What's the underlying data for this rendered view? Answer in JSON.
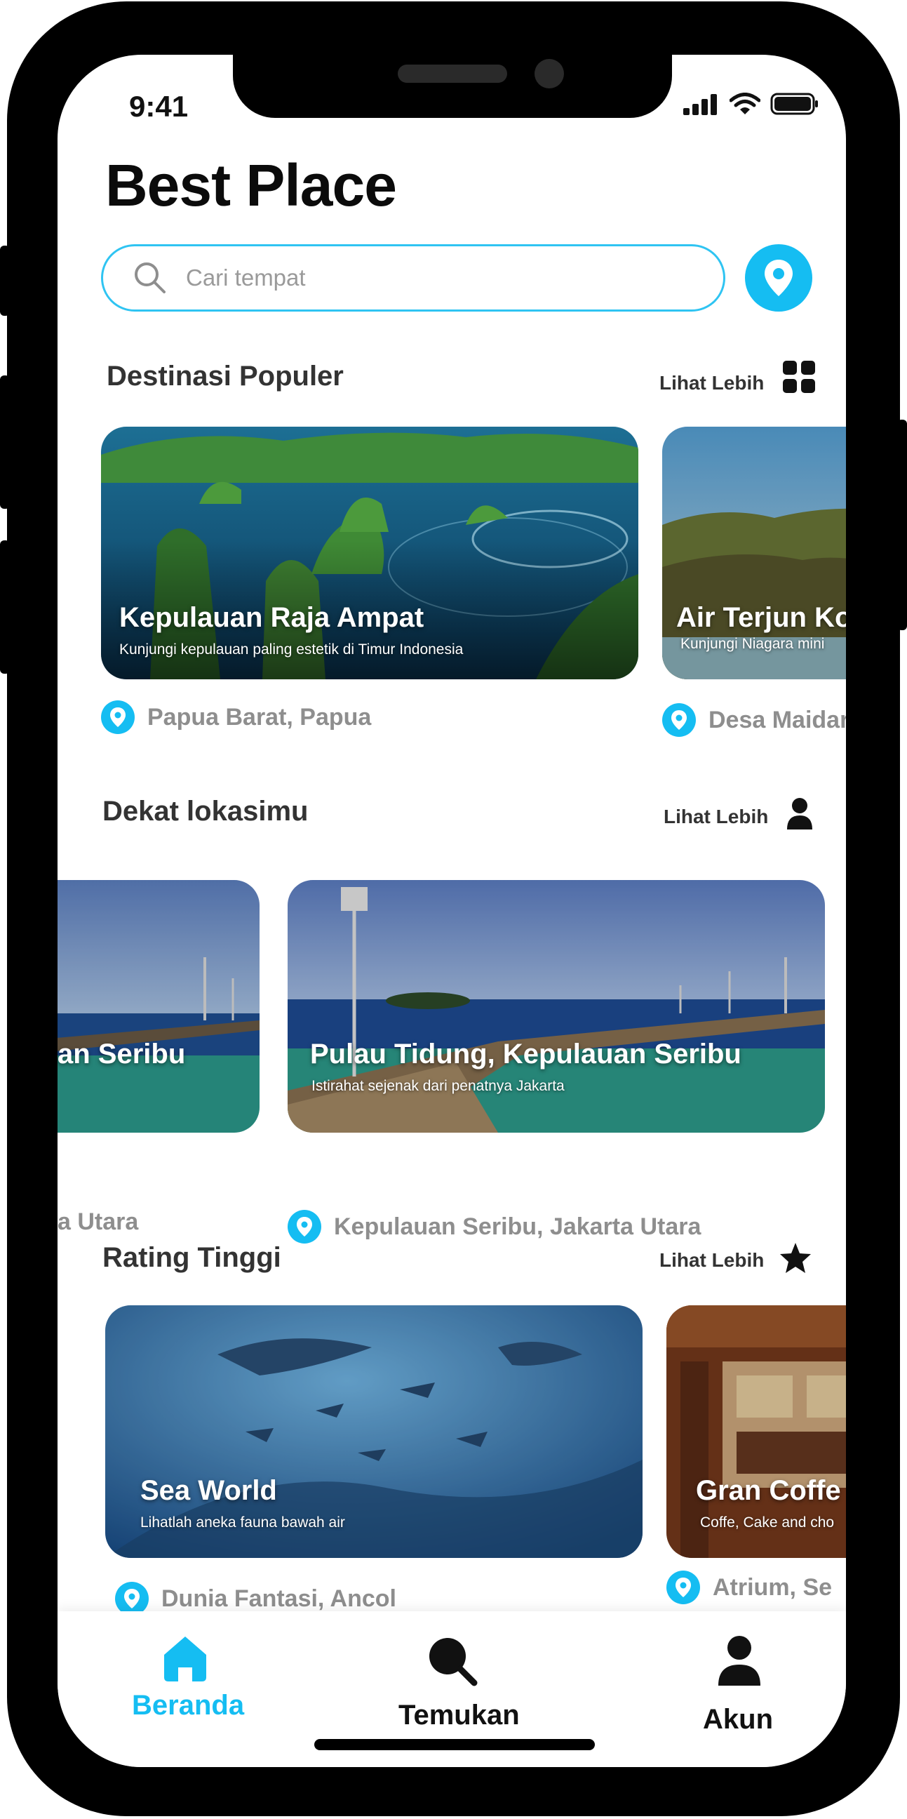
{
  "status": {
    "time": "9:41"
  },
  "title": "Best Place",
  "search": {
    "placeholder": "Cari tempat"
  },
  "sections": {
    "popular": {
      "title": "Destinasi Populer",
      "more": "Lihat Lebih",
      "cards": [
        {
          "title": "Kepulauan Raja Ampat",
          "subtitle": "Kunjungi kepulauan paling estetik di Timur Indonesia",
          "location": "Papua Barat, Papua"
        },
        {
          "title": "Air Terjun Ko",
          "subtitle": "Kunjungi Niagara mini",
          "location": "Desa Maidar"
        }
      ]
    },
    "nearby": {
      "title": "Dekat lokasimu",
      "more": "Lihat Lebih",
      "cards": [
        {
          "title": "an Seribu",
          "location": "a Utara"
        },
        {
          "title": "Pulau Tidung, Kepulauan Seribu",
          "subtitle": "Istirahat sejenak dari penatnya Jakarta",
          "location": "Kepulauan Seribu, Jakarta Utara"
        }
      ]
    },
    "rating": {
      "title": "Rating Tinggi",
      "more": "Lihat Lebih",
      "cards": [
        {
          "title": "Sea World",
          "subtitle": "Lihatlah aneka fauna bawah air",
          "location": "Dunia Fantasi, Ancol"
        },
        {
          "title": "Gran Coffe",
          "subtitle": "Coffe, Cake and cho",
          "location": "Atrium, Se"
        }
      ]
    }
  },
  "nav": {
    "items": [
      {
        "label": "Beranda",
        "icon": "home-icon",
        "active": true
      },
      {
        "label": "Temukan",
        "icon": "search-icon",
        "active": false
      },
      {
        "label": "Akun",
        "icon": "user-icon",
        "active": false
      }
    ]
  },
  "colors": {
    "accent": "#15bdf2",
    "text": "#0b0b0b",
    "muted": "#8e8e8e"
  }
}
